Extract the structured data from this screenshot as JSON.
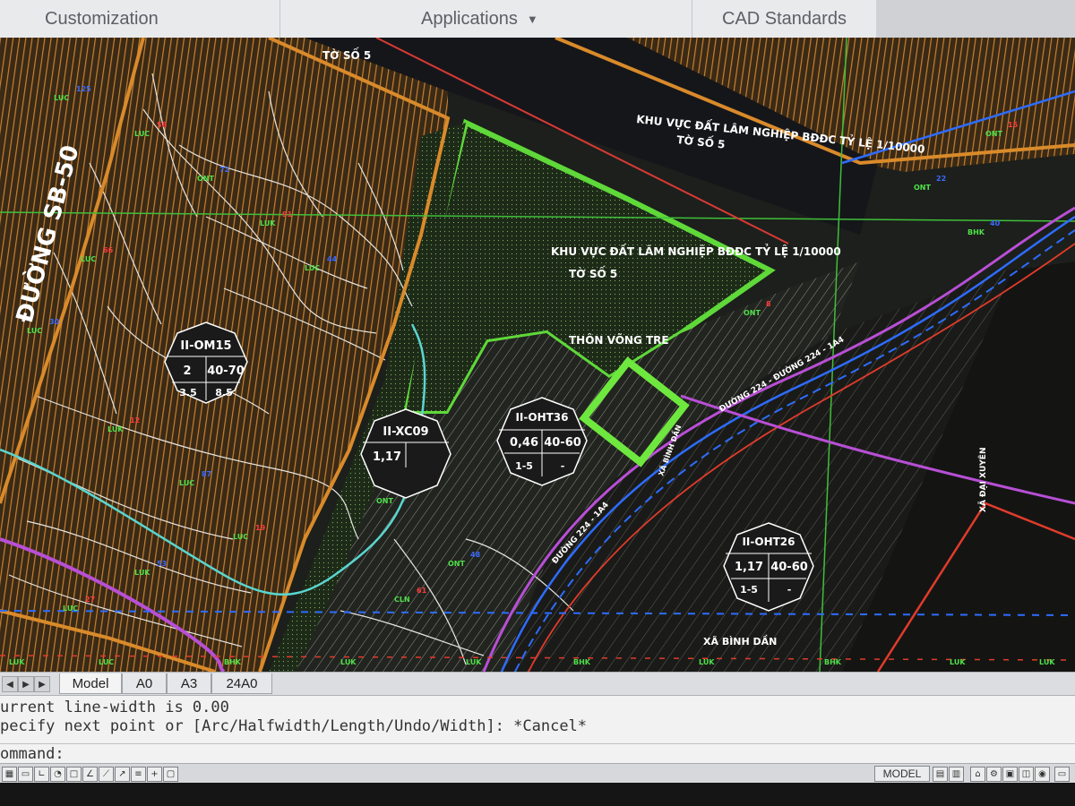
{
  "ribbon": {
    "tabs": [
      {
        "label": "Customization"
      },
      {
        "label": "Applications",
        "has_dropdown": true
      },
      {
        "label": "CAD Standards"
      }
    ]
  },
  "drawing": {
    "area_labels": {
      "forest_zone_top": "KHU VỰC ĐẤT LÂM NGHIỆP BĐĐC TỶ LỆ 1/10000",
      "sheet_top": "TỜ SỐ 5",
      "forest_zone_center": "KHU VỰC ĐẤT LÂM NGHIỆP BĐĐC TỶ LỆ 1/10000",
      "sheet_center": "TỜ SỐ 5",
      "sheet_topleft": "TỜ SỐ 5",
      "village": "THÔN VÕNG TRE",
      "commune_bottom": "XÃ BÌNH DẦN",
      "commune_right": "XÃ ĐẠI XUYÊN",
      "road_left": "ĐƯỜNG SB-50",
      "road_diag": "ĐƯỜNG 224 - ĐƯỜNG 224 - 1A4",
      "road_diag2": "ĐƯỜNG 224 - 1A4",
      "road_small": "XÃ BÌNH DẦN"
    },
    "zone_tags": [
      {
        "code": "II-OM15",
        "v1": "2",
        "v2": "40-70",
        "v3": "3.5",
        "v4": "8.5"
      },
      {
        "code": "II-XC09",
        "v1": "1,17",
        "v2": "",
        "v3": "",
        "v4": ""
      },
      {
        "code": "II-OHT36",
        "v1": "0,46",
        "v2": "40-60",
        "v3": "1-5",
        "v4": "-"
      },
      {
        "code": "II-OHT26",
        "v1": "1,17",
        "v2": "40-60",
        "v3": "1-5",
        "v4": "-"
      }
    ]
  },
  "layout_tabs": [
    "Model",
    "A0",
    "A3",
    "24A0"
  ],
  "command": {
    "history": [
      "urrent line-width is 0.00",
      "pecify next point or [Arc/Halfwidth/Length/Undo/Width]: *Cancel*"
    ],
    "prompt": "ommand:"
  },
  "status": {
    "model_label": "MODEL"
  },
  "colors": {
    "canvas": "#1c1f1b",
    "hatch_orange": "#c9802e",
    "parcel_line": "#e8e6e2",
    "forest_green": "#5fd83a",
    "road_purple": "#b84fd6",
    "road_blue": "#2e6cff",
    "boundary_red": "#e23b2b"
  }
}
